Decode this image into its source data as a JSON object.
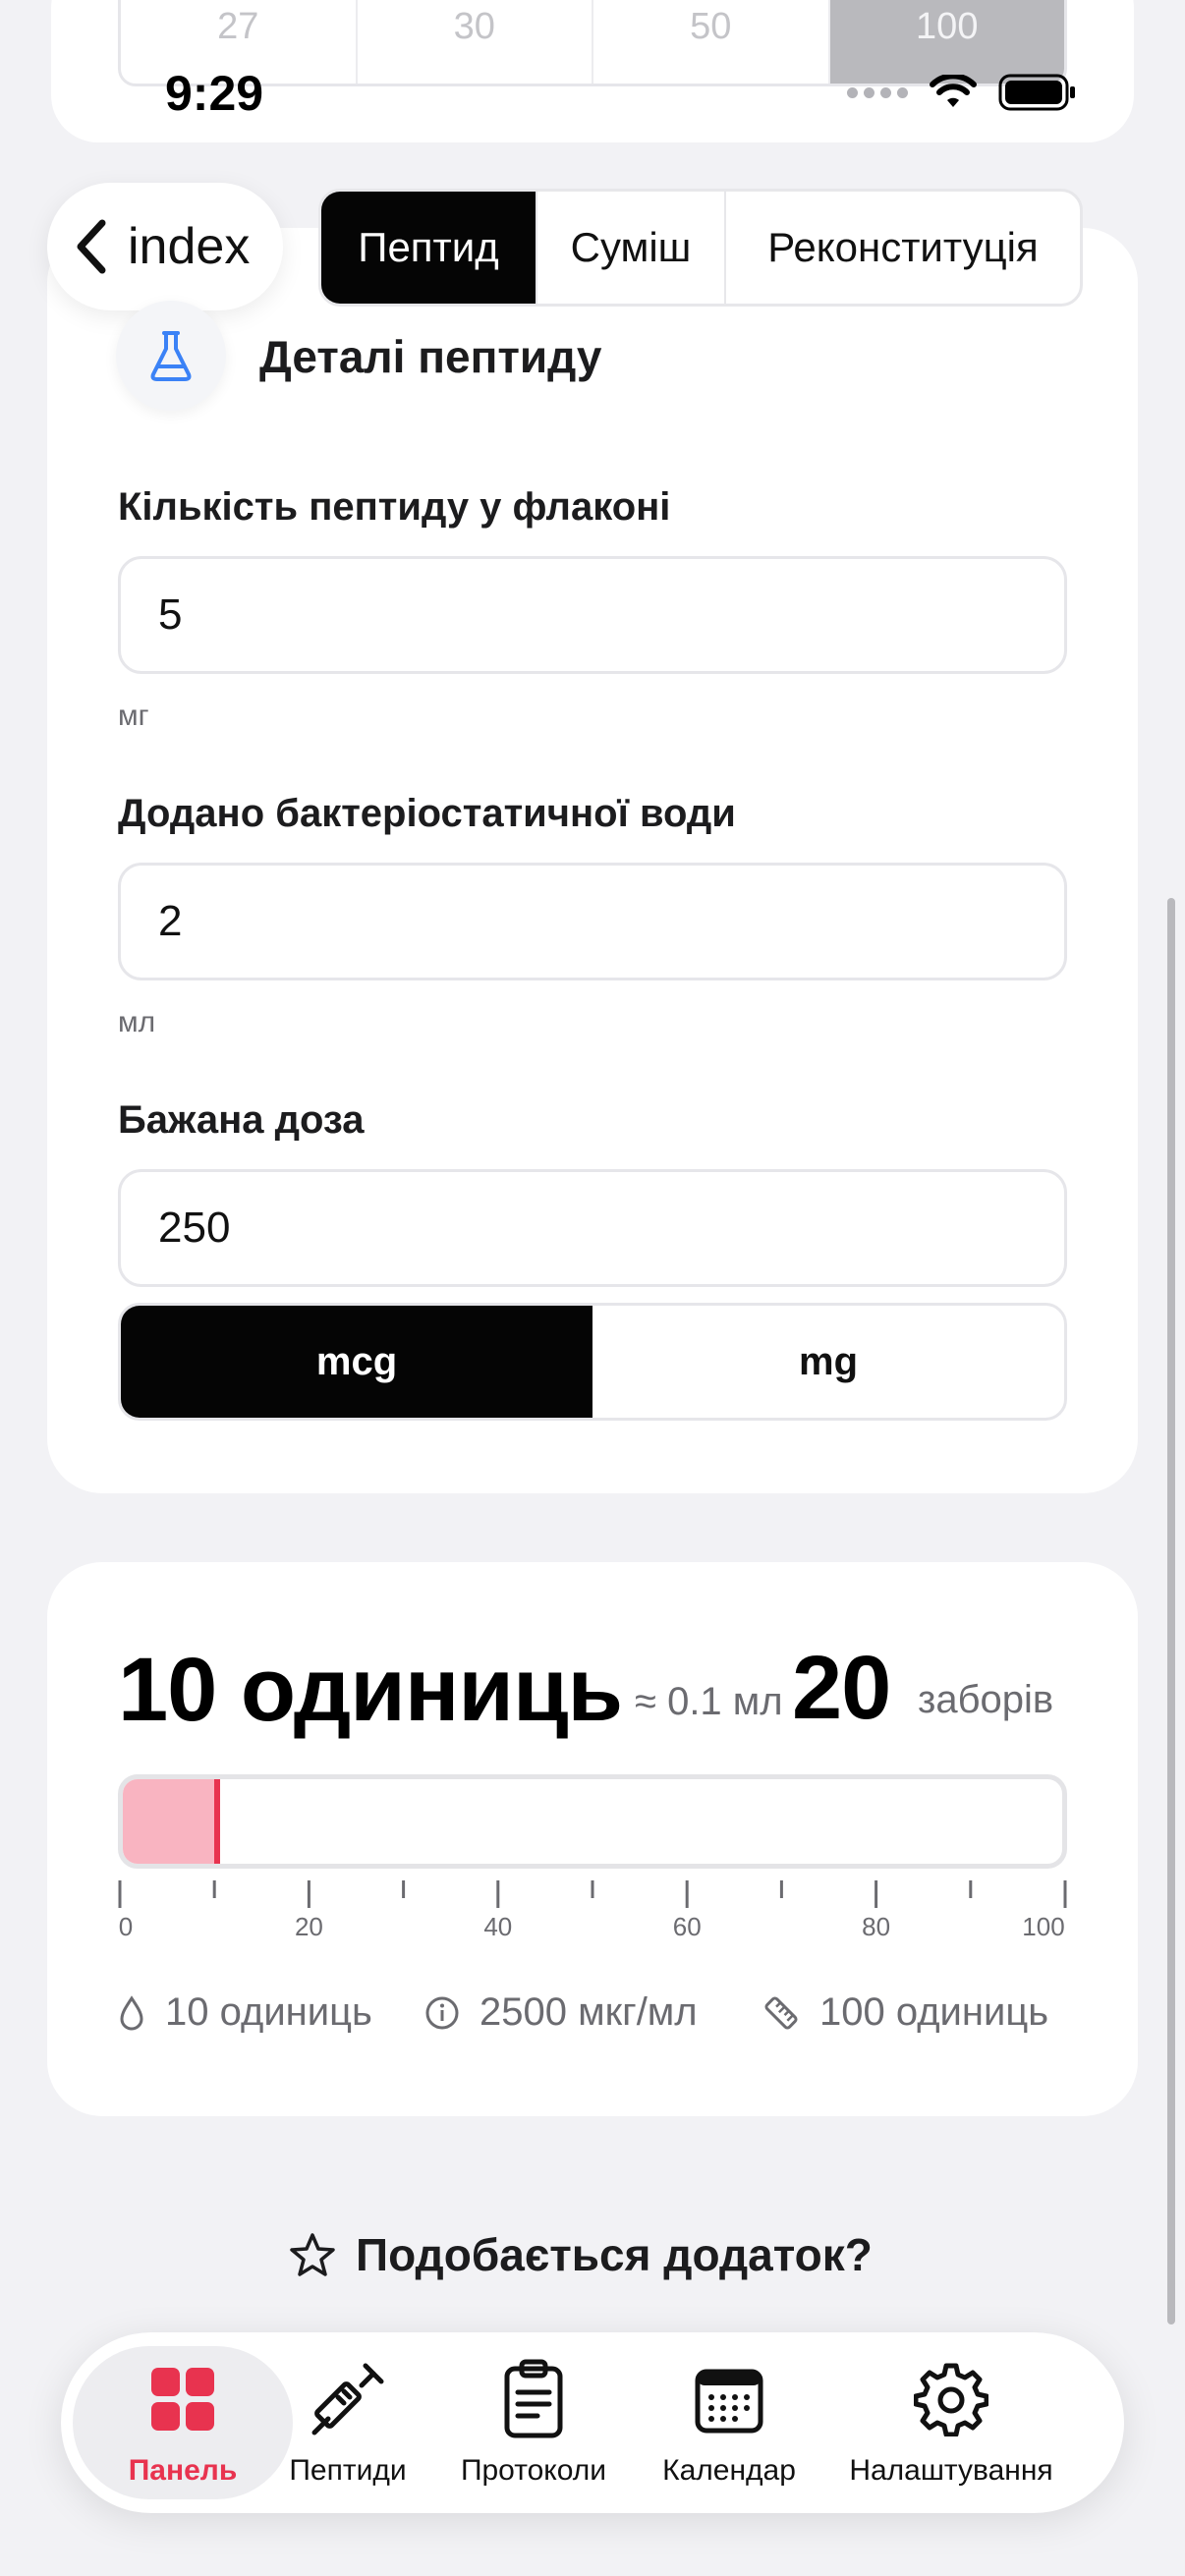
{
  "syringe_sizes": {
    "options": [
      "27",
      "30",
      "50",
      "100"
    ],
    "selected": "100"
  },
  "status_bar": {
    "time": "9:29"
  },
  "nav": {
    "back_label": "index",
    "modes": [
      "Пептид",
      "Суміш",
      "Реконституція"
    ],
    "selected_mode": "Пептид"
  },
  "details": {
    "title": "Деталі пептиду",
    "amount_label": "Кількість пептиду у флаконі",
    "amount_value": "5",
    "amount_unit": "мг",
    "water_label": "Додано бактеріостатичної води",
    "water_value": "2",
    "water_unit": "мл",
    "dose_label": "Бажана доза",
    "dose_value": "250",
    "dose_units": [
      "mcg",
      "mg"
    ],
    "selected_dose_unit": "mcg"
  },
  "result": {
    "units_text": "10 одиниць",
    "approx_text": "≈ 0.1 мл",
    "draws_number": "20",
    "draws_label": "заборів",
    "fill_units": 10,
    "scale_max": 100,
    "tick_labels": [
      "0",
      "20",
      "40",
      "60",
      "80",
      "100"
    ],
    "stat_dose": "10 одиниць",
    "stat_concentration": "2500 мкг/мл",
    "stat_syringe": "100 одиниць"
  },
  "like_prompt": "Подобається додаток?",
  "tabs": [
    "Панель",
    "Пептиди",
    "Протоколи",
    "Календар",
    "Налаштування"
  ],
  "active_tab": "Панель",
  "colors": {
    "accent": "#e8334f",
    "fill": "#f9b4c1",
    "flask": "#3b82f6",
    "selected": "#050505"
  }
}
